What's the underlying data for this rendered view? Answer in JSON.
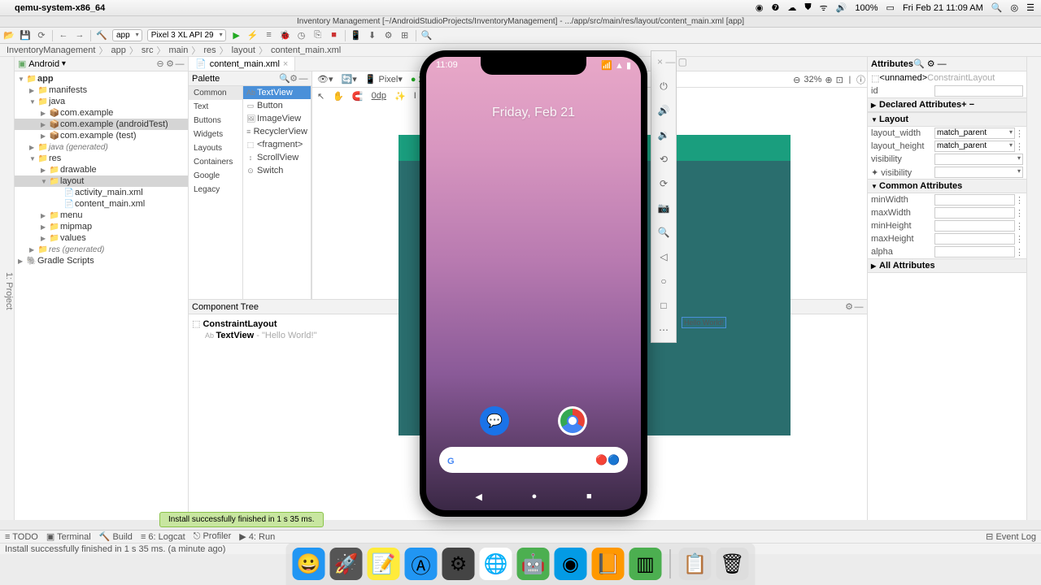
{
  "menubar": {
    "app": "qemu-system-x86_64",
    "battery": "100%",
    "clock": "Fri Feb 21  11:09 AM"
  },
  "window": {
    "title": "Inventory Management [~/AndroidStudioProjects/InventoryManagement] - .../app/src/main/res/layout/content_main.xml [app]"
  },
  "toolbar": {
    "config": "app",
    "device": "Pixel 3 XL API 29"
  },
  "breadcrumb": [
    "InventoryManagement",
    "app",
    "src",
    "main",
    "res",
    "layout",
    "content_main.xml"
  ],
  "project": {
    "view": "Android",
    "tree": {
      "app": "app",
      "manifests": "manifests",
      "java": "java",
      "pkg1": "com.example",
      "pkg2": "com.example (androidTest)",
      "pkg3": "com.example (test)",
      "javagen": "java (generated)",
      "res": "res",
      "drawable": "drawable",
      "layout": "layout",
      "activity": "activity_main.xml",
      "content": "content_main.xml",
      "menu": "menu",
      "mipmap": "mipmap",
      "values": "values",
      "resgen": "res (generated)",
      "gradle": "Gradle Scripts"
    }
  },
  "tab": {
    "name": "content_main.xml"
  },
  "palette": {
    "title": "Palette",
    "categories": [
      "Common",
      "Text",
      "Buttons",
      "Widgets",
      "Layouts",
      "Containers",
      "Google",
      "Legacy"
    ],
    "items": [
      "TextView",
      "Button",
      "ImageView",
      "RecyclerView",
      "<fragment>",
      "ScrollView",
      "Switch"
    ]
  },
  "layoutbar": {
    "pixel": "Pixel",
    "dp": "0dp"
  },
  "componentTree": {
    "title": "Component Tree",
    "root": "ConstraintLayout",
    "child": "TextView",
    "childText": "- \"Hello World!\""
  },
  "zoom": {
    "pct": "32%"
  },
  "attributes": {
    "title": "Attributes",
    "unnamed": "<unnamed>",
    "type": "ConstraintLayout",
    "id_label": "id",
    "declared": "Declared Attributes",
    "layout": "Layout",
    "width_label": "layout_width",
    "width_val": "match_parent",
    "height_label": "layout_height",
    "height_val": "match_parent",
    "visibility": "visibility",
    "fvisibility": "visibility",
    "common": "Common Attributes",
    "minWidth": "minWidth",
    "maxWidth": "maxWidth",
    "minHeight": "minHeight",
    "maxHeight": "maxHeight",
    "alpha": "alpha",
    "all": "All Attributes"
  },
  "emulator": {
    "time": "11:09",
    "date": "Friday, Feb 21"
  },
  "hello": "Hello World!",
  "toast": "Install successfully finished in 1 s 35 ms.",
  "bottombar": {
    "todo": "TODO",
    "terminal": "Terminal",
    "build": "Build",
    "logcat": "Logcat",
    "profiler": "Profiler",
    "run": "Run",
    "eventlog": "Event Log"
  },
  "status": "Install successfully finished in 1 s 35 ms. (a minute ago)"
}
